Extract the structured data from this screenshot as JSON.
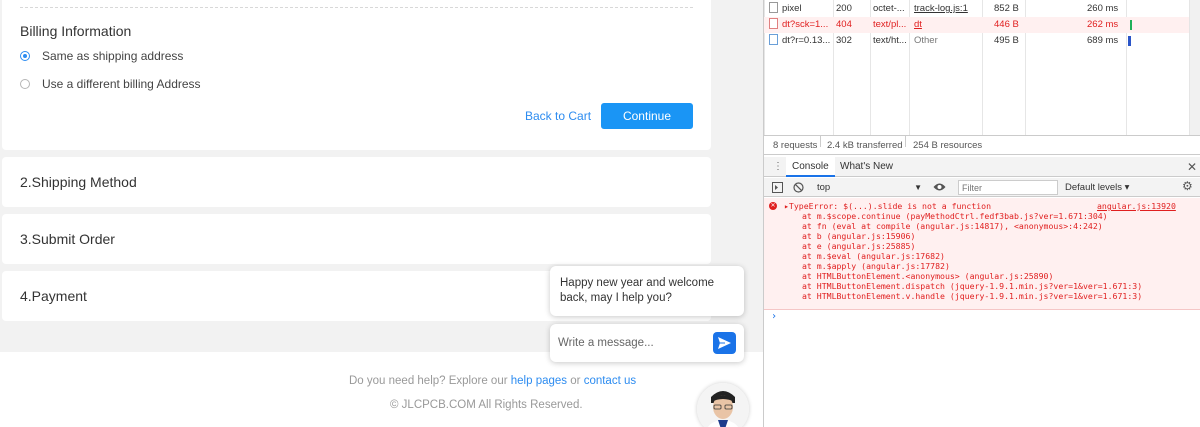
{
  "billing": {
    "title": "Billing Information",
    "options": [
      {
        "label": "Same as shipping address",
        "checked": true
      },
      {
        "label": "Use a different billing Address",
        "checked": false
      }
    ],
    "back_label": "Back to Cart",
    "continue_label": "Continue"
  },
  "steps": [
    {
      "label": "2.Shipping Method"
    },
    {
      "label": "3.Submit Order"
    },
    {
      "label": "4.Payment"
    }
  ],
  "footer": {
    "help_prefix": "Do you need help? Explore our",
    "help_link": "help pages",
    "or": "or",
    "contact_link": "contact us",
    "copyright": "© JLCPCB.COM All Rights Reserved."
  },
  "chat": {
    "greeting": "Happy new year and welcome back, may I help you?",
    "input_placeholder": "Write a message...",
    "send_icon": "send-icon"
  },
  "network": {
    "rows": [
      {
        "name": "pixel",
        "status": "200",
        "type": "octet-...",
        "initiator": "track-log.js:1",
        "size": "852 B",
        "time": "260 ms",
        "error": false,
        "initiator_link": true
      },
      {
        "name": "dt?sck=1...",
        "status": "404",
        "type": "text/pl...",
        "initiator": "dt",
        "size": "446 B",
        "time": "262 ms",
        "error": true,
        "initiator_link": true
      },
      {
        "name": "dt?r=0.13...",
        "status": "302",
        "type": "text/ht...",
        "initiator": "Other",
        "size": "495 B",
        "time": "689 ms",
        "error": false,
        "initiator_link": false
      }
    ],
    "summary": {
      "requests": "8 requests",
      "transferred": "2.4 kB transferred",
      "resources": "254 B resources"
    }
  },
  "drawer": {
    "tabs": [
      "Console",
      "What's New"
    ],
    "context": "top",
    "filter_placeholder": "Filter",
    "levels": "Default levels ▾"
  },
  "console": {
    "error_head": "▸TypeError: $(...).slide is not a function",
    "source": "angular.js:13920",
    "stack": [
      "at m.$scope.continue (payMethodCtrl.fedf3bab.js?ver=1.671:304)",
      "at fn (eval at compile (angular.js:14817), <anonymous>:4:242)",
      "at b (angular.js:15906)",
      "at e (angular.js:25885)",
      "at m.$eval (angular.js:17682)",
      "at m.$apply (angular.js:17782)",
      "at HTMLButtonElement.<anonymous> (angular.js:25890)",
      "at HTMLButtonElement.dispatch (jquery-1.9.1.min.js?ver=1&ver=1.671:3)",
      "at HTMLButtonElement.v.handle (jquery-1.9.1.min.js?ver=1&ver=1.671:3)"
    ],
    "prompt": "›"
  }
}
